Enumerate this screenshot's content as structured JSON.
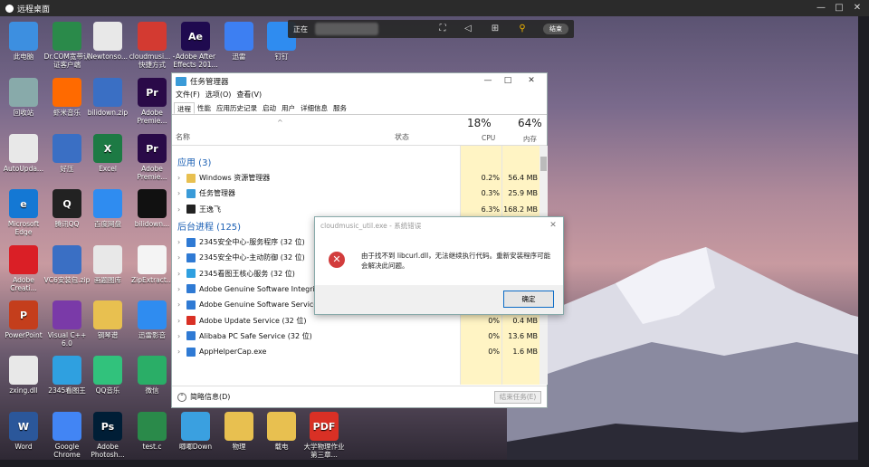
{
  "window": {
    "title": "远程桌面",
    "controls": [
      "—",
      "□",
      "✕"
    ]
  },
  "toolbar": {
    "status_text": "正在",
    "end_label": "结束"
  },
  "desktop_icons": [
    {
      "label": "此电脑",
      "icon": "computer-icon",
      "color": "#3d8fe0"
    },
    {
      "label": "Dr.COM宽带认证客户端",
      "icon": "drcom-icon",
      "color": "#2a8a4a"
    },
    {
      "label": "Newtonso...",
      "icon": "file-icon",
      "color": "#e8e8e8"
    },
    {
      "label": "cloudmusi... - 快捷方式",
      "icon": "netease-music-icon",
      "color": "#d33a31"
    },
    {
      "label": "Adobe After Effects 201...",
      "icon": "ae-icon",
      "color": "#1f0a4f"
    },
    {
      "label": "迅雷",
      "icon": "thunder-icon",
      "color": "#3d7ff2"
    },
    {
      "label": "钉钉",
      "icon": "dingtalk-icon",
      "color": "#2f8cf0"
    },
    {
      "label": "回收站",
      "icon": "recycle-bin-icon",
      "color": "#8aa"
    },
    {
      "label": "虾米音乐",
      "icon": "xiami-icon",
      "color": "#ff6a00"
    },
    {
      "label": "bilidown.zip",
      "icon": "zip-icon",
      "color": "#3a6fc4"
    },
    {
      "label": "Adobe Premie...",
      "icon": "pr-icon",
      "color": "#2a0a48"
    },
    {
      "label": "AutoUpda...",
      "icon": "file-icon",
      "color": "#e8e8e8"
    },
    {
      "label": "好压",
      "icon": "haozip-icon",
      "color": "#3a6fc4"
    },
    {
      "label": "Excel",
      "icon": "excel-icon",
      "color": "#1d7a44"
    },
    {
      "label": "Adobe Premie...",
      "icon": "pr-icon",
      "color": "#2a0a48"
    },
    {
      "label": "Microsoft Edge",
      "icon": "edge-icon",
      "color": "#1478d4"
    },
    {
      "label": "腾讯QQ",
      "icon": "qq-icon",
      "color": "#222"
    },
    {
      "label": "百度网盘",
      "icon": "baidu-pan-icon",
      "color": "#2f8cf0"
    },
    {
      "label": "bilidown...",
      "icon": "bilidown-icon",
      "color": "#111"
    },
    {
      "label": "Adobe Creati...",
      "icon": "creative-cloud-icon",
      "color": "#da1f26"
    },
    {
      "label": "VC6安装包.zip",
      "icon": "zip-icon",
      "color": "#3a6fc4"
    },
    {
      "label": "画题图库",
      "icon": "file-icon",
      "color": "#e8e8e8"
    },
    {
      "label": "ZipExtract...",
      "icon": "file-icon",
      "color": "#f4f4f4"
    },
    {
      "label": "PowerPoint",
      "icon": "powerpoint-icon",
      "color": "#c43e1c"
    },
    {
      "label": "Visual C++ 6.0",
      "icon": "vc-icon",
      "color": "#7a3aa8"
    },
    {
      "label": "钢琴谱",
      "icon": "folder-icon",
      "color": "#e8c050"
    },
    {
      "label": "迅雷影音",
      "icon": "thunder-player-icon",
      "color": "#2f8cf0"
    },
    {
      "label": "zxing.dll",
      "icon": "dll-icon",
      "color": "#e8e8e8"
    },
    {
      "label": "2345看图王",
      "icon": "kantu-icon",
      "color": "#2fa0e0"
    },
    {
      "label": "QQ音乐",
      "icon": "qqmusic-icon",
      "color": "#31c27c"
    },
    {
      "label": "微信",
      "icon": "wechat-icon",
      "color": "#2aae67"
    },
    {
      "label": "Word",
      "icon": "word-icon",
      "color": "#2b579a"
    },
    {
      "label": "Google Chrome",
      "icon": "chrome-icon",
      "color": "#4285f4"
    },
    {
      "label": "Adobe Photosh...",
      "icon": "ps-icon",
      "color": "#001e36"
    },
    {
      "label": "test.c",
      "icon": "c-file-icon",
      "color": "#2a8a4a"
    },
    {
      "label": "唧唧Down",
      "icon": "jijidown-icon",
      "color": "#3aa0e0"
    },
    {
      "label": "物理",
      "icon": "folder-icon",
      "color": "#e8c050"
    },
    {
      "label": "载电",
      "icon": "folder-icon",
      "color": "#e8c050"
    },
    {
      "label": "大学物理作业第三章...",
      "icon": "pdf-icon",
      "color": "#d93025"
    }
  ],
  "taskmgr": {
    "title": "任务管理器",
    "menus": [
      "文件(F)",
      "选项(O)",
      "查看(V)"
    ],
    "tabs": [
      "进程",
      "性能",
      "应用历史记录",
      "启动",
      "用户",
      "详细信息",
      "服务"
    ],
    "col_name": "名称",
    "col_status": "状态",
    "cpu_pct": "18%",
    "cpu_label": "CPU",
    "mem_pct": "64%",
    "mem_label": "内存",
    "apps_group": "应用 (3)",
    "bg_group": "后台进程 (125)",
    "apps": [
      {
        "name": "Windows 资源管理器",
        "cpu": "0.2%",
        "mem": "56.4 MB",
        "icon_color": "#e8c050"
      },
      {
        "name": "任务管理器",
        "cpu": "0.3%",
        "mem": "25.9 MB",
        "icon_color": "#3a9bd8"
      },
      {
        "name": "王逸飞",
        "cpu": "6.3%",
        "mem": "168.2 MB",
        "icon_color": "#222"
      }
    ],
    "bg": [
      {
        "name": "2345安全中心-服务程序 (32 位)",
        "cpu": "",
        "mem": "",
        "icon_color": "#2f7ad4"
      },
      {
        "name": "2345安全中心-主动防御 (32 位)",
        "cpu": "",
        "mem": "",
        "icon_color": "#2f7ad4"
      },
      {
        "name": "2345看图王核心服务 (32 位)",
        "cpu": "",
        "mem": "",
        "icon_color": "#2fa0e0"
      },
      {
        "name": "Adobe Genuine Software Integrity",
        "cpu": "",
        "mem": "",
        "icon_color": "#2f7ad4"
      },
      {
        "name": "Adobe Genuine Software Service (3",
        "cpu": "",
        "mem": "",
        "icon_color": "#2f7ad4"
      },
      {
        "name": "Adobe Update Service (32 位)",
        "cpu": "0%",
        "mem": "0.4 MB",
        "icon_color": "#d93025"
      },
      {
        "name": "Alibaba PC Safe Service (32 位)",
        "cpu": "0%",
        "mem": "13.6 MB",
        "icon_color": "#2f7ad4"
      },
      {
        "name": "AppHelperCap.exe",
        "cpu": "0%",
        "mem": "1.6 MB",
        "icon_color": "#2f7ad4"
      }
    ],
    "footer_less": "简略信息(D)",
    "end_task": "结束任务(E)"
  },
  "dialog": {
    "title": "cloudmusic_util.exe - 系统错误",
    "message": "由于找不到 libcurl.dll，无法继续执行代码。重新安装程序可能会解决此问题。",
    "ok": "确定"
  }
}
